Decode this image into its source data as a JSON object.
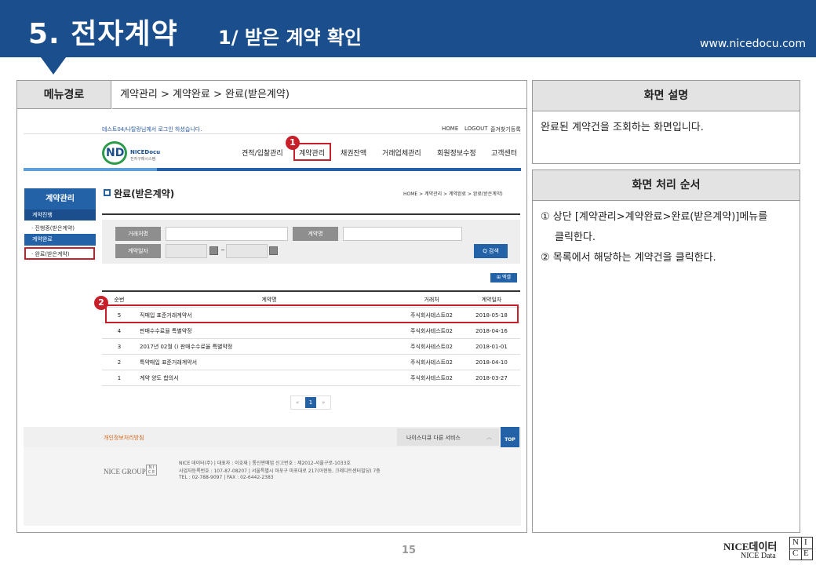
{
  "header": {
    "title": "5. 전자계약",
    "subtitle": "1/ 받은 계약 확인",
    "url": "www.nicedocu.com"
  },
  "menu_path": {
    "label": "메뉴경로",
    "value": "계약관리 > 계약완료 > 완료(받은계약)"
  },
  "screen_desc": {
    "title": "화면 설명",
    "text": "완료된 계약건을 조회하는 화면입니다."
  },
  "process": {
    "title": "화면 처리 순서",
    "steps": [
      "① 상단 [계약관리>계약완료>완료(받은계약)]메뉴를",
      "클릭한다.",
      "② 목록에서 해당하는 계약건을 클릭한다."
    ]
  },
  "mini": {
    "login_text": "테스트04/나탈랑님께서 로그인 하셨습니다.",
    "top_links": [
      "HOME",
      "LOGOUT",
      "즐겨찾기등록"
    ],
    "logo_text": "NICEDocu",
    "logo_sub": "전자구매시스템",
    "nav": [
      "견적/입찰관리",
      "계약관리",
      "채권잔액",
      "거래업체관리",
      "회원정보수정",
      "고객센터"
    ],
    "side": {
      "title": "계약관리",
      "sec1": "계약진행",
      "item1": "· 진행중(받은계약)",
      "sec2": "계약완료",
      "item2": "· 완료(받은계약)"
    },
    "page_title": "완료(받은계약)",
    "breadcrumb": "HOME > 계약관리 > 계약완료 > 완료(받은계약)",
    "form": {
      "vendor_label": "거래처명",
      "contract_label": "계약명",
      "date_label": "계약일자",
      "date_sep": "~",
      "search_btn": "Q 검색"
    },
    "excel_btn": "⊞ 엑셀",
    "columns": [
      "순번",
      "계약명",
      "거래처",
      "계약일자"
    ],
    "rows": [
      {
        "no": "5",
        "name": "직매입 표준거래계약서",
        "vendor": "주식회사테스트02",
        "date": "2018-05-18"
      },
      {
        "no": "4",
        "name": "판매수수료율 특별약정",
        "vendor": "주식회사테스트02",
        "date": "2018-04-16"
      },
      {
        "no": "3",
        "name": "2017년 02월 () 판매수수료율 특별약정",
        "vendor": "주식회사테스트02",
        "date": "2018-01-01"
      },
      {
        "no": "2",
        "name": "특약매입 표준거래계약서",
        "vendor": "주식회사테스트02",
        "date": "2018-04-10"
      },
      {
        "no": "1",
        "name": "계약 양도 합의서",
        "vendor": "주식회사테스트02",
        "date": "2018-03-27"
      }
    ],
    "pager": [
      "«",
      "1",
      "»"
    ],
    "privacy": "개인정보처리방침",
    "family": "나이스디큐 다른 서비스",
    "top_btn": "TOP",
    "group": "NICE GROUP",
    "company": [
      "NICE 데이터(주)  |  대표자 : 이호재  |  통신판매업 신고번호 : 제2012-서울구로-1033호",
      "사업자등록번호 : 107-87-08207  |  서울특별시 마포구 마포대로 217(아현동, 크레디트센터빌딩) 7층",
      "TEL : 02-788-9097  |  FAX : 02-6442-2383"
    ]
  },
  "badges": [
    "1",
    "2"
  ],
  "page_number": "15",
  "brand": {
    "name": "NICE데이터",
    "sub": "NICE Data"
  }
}
